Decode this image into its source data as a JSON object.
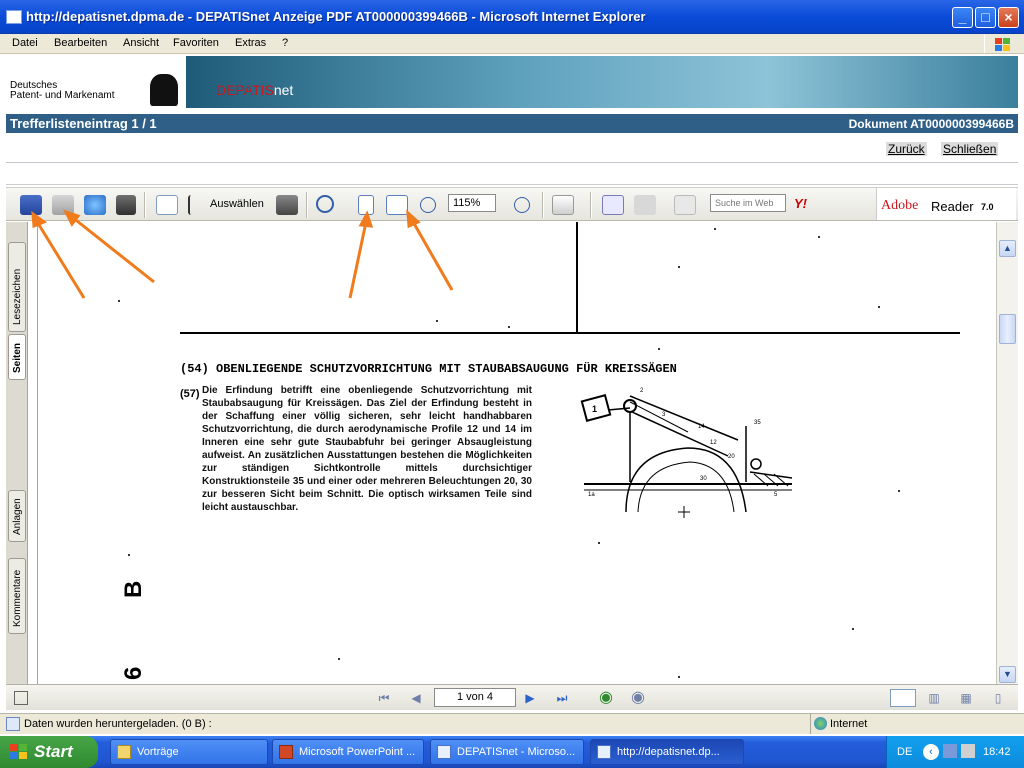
{
  "window": {
    "title": "http://depatisnet.dpma.de - DEPATISnet Anzeige PDF AT000000399466B - Microsoft Internet Explorer",
    "minimize": "_",
    "maximize": "□",
    "close": "×"
  },
  "menu": [
    "Datei",
    "Bearbeiten",
    "Ansicht",
    "Favoriten",
    "Extras",
    "?"
  ],
  "banner": {
    "org_line1": "Deutsches",
    "org_line2": "Patent- und Markenamt",
    "brand_red": "DEPATIS",
    "brand_white": "net"
  },
  "header": {
    "left": "Trefferlisteneintrag 1 / 1",
    "right": "Dokument AT000000399466B"
  },
  "links": {
    "back": "Zurück",
    "close": "Schließen"
  },
  "toolbar": {
    "select_label": "Auswählen",
    "zoom_value": "115%",
    "search_placeholder": "Suche im Web",
    "yahoo": "Y!",
    "adobe_brand": "Adobe",
    "adobe_product": "Reader",
    "adobe_version": "7.0"
  },
  "left_tabs": [
    "Lesezeichen",
    "Seiten",
    "Anlagen",
    "Kommentare"
  ],
  "document": {
    "heading": "(54) OBENLIEGENDE SCHUTZVORRICHTUNG MIT STAUBABSAUGUNG FÜR KREISSÄGEN",
    "abstract_num": "(57)",
    "abstract": "Die Erfindung betrifft eine obenliegende Schutzvorrichtung mit Staubabsaugung für Kreissägen. Das Ziel der Erfindung besteht in der Schaffung einer völlig sicheren, sehr leicht handhabbaren Schutzvorrichtung, die durch aerodynamische Profile 12 und 14 im Inneren eine sehr gute Staubabfuhr bei geringer Absaugleistung aufweist. An zusätzlichen Ausstattungen bestehen die Möglichkeiten zur ständigen Sichtkontrolle mittels durchsichtiger Konstruktionsteile 35 und einer oder mehreren Beleuchtungen 20, 30 zur besseren Sicht beim Schnitt. Die optisch wirksamen Teile sind leicht austauschbar.",
    "side_letter": "B",
    "side_digit": "6",
    "figure_labels": [
      "1",
      "2",
      "3",
      "14",
      "12",
      "20",
      "30",
      "35",
      "1a",
      "5"
    ]
  },
  "navigation": {
    "page_display": "1 von 4"
  },
  "status": {
    "text": "Daten wurden heruntergeladen. (0 B) :",
    "zone": "Internet"
  },
  "taskbar": {
    "start": "Start",
    "tasks": [
      "Vorträge",
      "Microsoft PowerPoint ...",
      "DEPATISnet - Microso...",
      "http://depatisnet.dp..."
    ],
    "lang": "DE",
    "clock": "18:42"
  },
  "colors": {
    "accent_arrow": "#f07b1c",
    "xp_blue": "#0a4bd8",
    "header_blue": "#2f5f87",
    "brand_red": "#c8171e"
  }
}
